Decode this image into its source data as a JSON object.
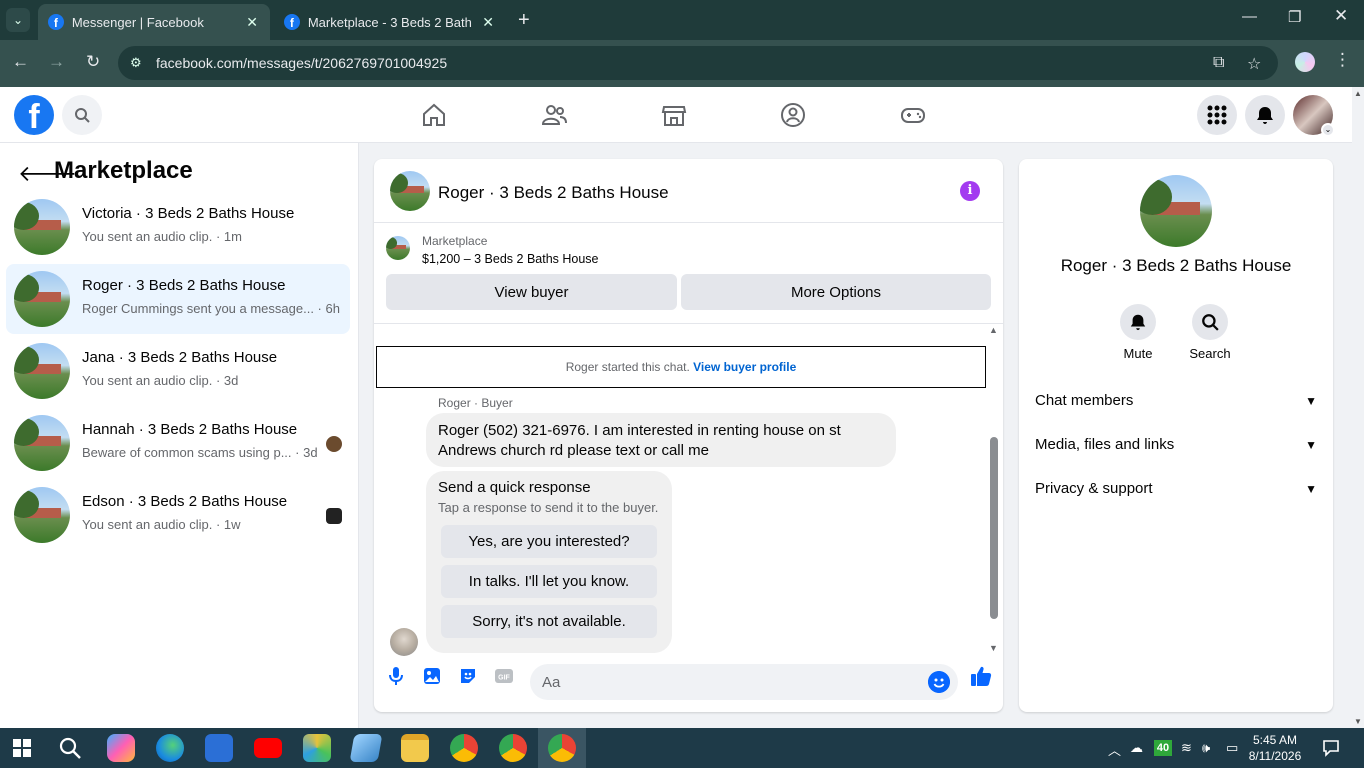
{
  "browser": {
    "tabs": [
      {
        "title": "Messenger | Facebook",
        "active": true
      },
      {
        "title": "Marketplace - 3 Beds 2 Baths H",
        "active": false
      }
    ],
    "url": "facebook.com/messages/t/2062769701004925"
  },
  "sidebar": {
    "title": "Marketplace",
    "conversations": [
      {
        "name": "Victoria · 3 Beds 2 Baths House",
        "preview": "You sent an audio clip. · 1m",
        "selected": false
      },
      {
        "name": "Roger · 3 Beds 2 Baths House",
        "preview": "Roger Cummings sent you a message... · 6h",
        "selected": true
      },
      {
        "name": "Jana · 3 Beds 2 Baths House",
        "preview": "You sent an audio clip. · 3d",
        "selected": false
      },
      {
        "name": "Hannah · 3 Beds 2 Baths House",
        "preview": "Beware of common scams using p... · 3d",
        "selected": false
      },
      {
        "name": "Edson · 3 Beds 2 Baths House",
        "preview": "You sent an audio clip. · 1w",
        "selected": false
      }
    ]
  },
  "chat": {
    "title": "Roger · 3 Beds 2 Baths House",
    "marketplace_label": "Marketplace",
    "listing": "$1,200 – 3 Beds 2 Baths House",
    "view_buyer": "View buyer",
    "more_options": "More Options",
    "started_text": "Roger started this chat.",
    "view_profile": "View buyer profile",
    "sender_label": "Roger · Buyer",
    "message_line1": "Roger (502) 321-6976. I am interested in renting house on st",
    "message_line2": "Andrews church rd please text or call me",
    "quick_title": "Send a quick response",
    "quick_sub": "Tap a response to send it to the buyer.",
    "quick_replies": [
      "Yes, are you interested?",
      "In talks. I'll let you know.",
      "Sorry, it's not available."
    ],
    "composer_placeholder": "Aa"
  },
  "right_panel": {
    "title": "Roger · 3 Beds 2 Baths House",
    "mute": "Mute",
    "search": "Search",
    "sections": [
      "Chat members",
      "Media, files and links",
      "Privacy & support"
    ]
  },
  "taskbar": {
    "time": "5:45 AM",
    "date": "8/11/2026",
    "badge": "40"
  },
  "colors": {
    "fb_blue": "#1877f2",
    "accent": "#0866ff",
    "info_purple": "#a33bf0",
    "selected_bg": "#ebf5ff"
  }
}
